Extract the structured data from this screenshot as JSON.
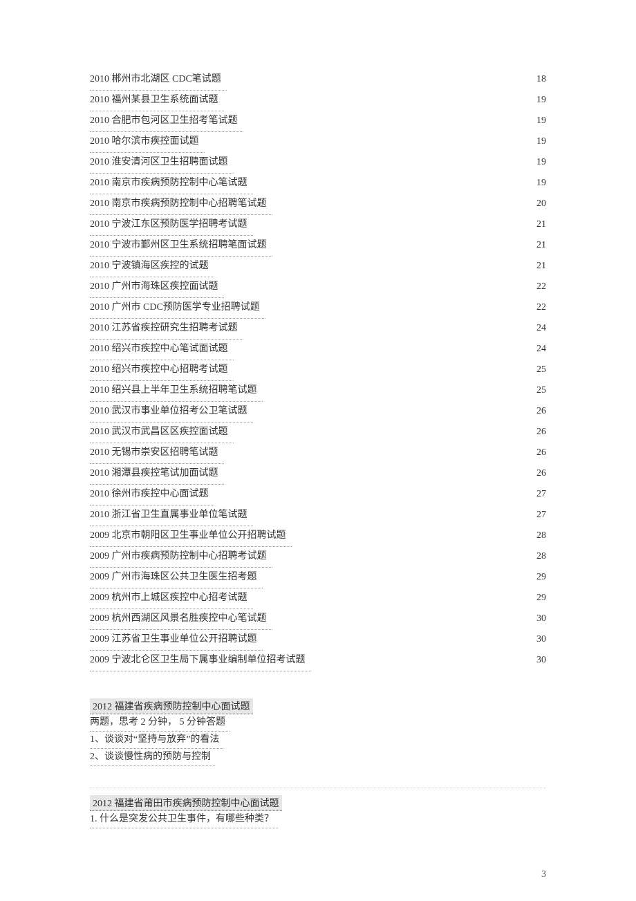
{
  "toc": [
    {
      "title": "2010 郴州市北湖区   CDC笔试题",
      "page": "18"
    },
    {
      "title": "2010 福州某县卫生系统面试题",
      "page": "19"
    },
    {
      "title": "2010 合肥市包河区卫生招考笔试题",
      "page": "19"
    },
    {
      "title": "2010 哈尔滨市疾控面试题",
      "page": "19"
    },
    {
      "title": "2010 淮安清河区卫生招聘面试题",
      "page": "19"
    },
    {
      "title": "2010 南京市疾病预防控制中心笔试题",
      "page": "19"
    },
    {
      "title": "2010 南京市疾病预防控制中心招聘笔试题",
      "page": "20"
    },
    {
      "title": "2010 宁波江东区预防医学招聘考试题",
      "page": "21"
    },
    {
      "title": "2010 宁波市鄞州区卫生系统招聘笔面试题",
      "page": "21"
    },
    {
      "title": "2010 宁波镇海区疾控的试题",
      "page": "21"
    },
    {
      "title": "2010 广州市海珠区疾控面试题",
      "page": "22"
    },
    {
      "title": "2010 广州市  CDC预防医学专业招聘试题",
      "page": "22"
    },
    {
      "title": "2010 江苏省疾控研究生招聘考试题",
      "page": "24"
    },
    {
      "title": "2010 绍兴市疾控中心笔试面试题",
      "page": "24"
    },
    {
      "title": "2010 绍兴市疾控中心招聘考试题",
      "page": "25"
    },
    {
      "title": "2010 绍兴县上半年卫生系统招聘笔试题",
      "page": "25"
    },
    {
      "title": "2010 武汉市事业单位招考公卫笔试题",
      "page": "26"
    },
    {
      "title": "2010 武汉市武昌区区疾控面试题",
      "page": "26"
    },
    {
      "title": "2010 无锡市崇安区招聘笔试题",
      "page": "26"
    },
    {
      "title": "2010 湘潭县疾控笔试加面试题",
      "page": "26"
    },
    {
      "title": "2010 徐州市疾控中心面试题",
      "page": "27"
    },
    {
      "title": "2010 浙江省卫生直属事业单位笔试题",
      "page": "27"
    },
    {
      "title": "2009 北京市朝阳区卫生事业单位公开招聘试题",
      "page": "28"
    },
    {
      "title": "2009 广州市疾病预防控制中心招聘考试题",
      "page": "28"
    },
    {
      "title": "2009 广州市海珠区公共卫生医生招考题",
      "page": "29"
    },
    {
      "title": "2009 杭州市上城区疾控中心招考试题",
      "page": "29"
    },
    {
      "title": "2009 杭州西湖区风景名胜疾控中心笔试题",
      "page": "30"
    },
    {
      "title": "2009 江苏省卫生事业单位公开招聘试题",
      "page": "30"
    },
    {
      "title": "2009 宁波北仑区卫生局下属事业编制单位招考试题",
      "page": "30"
    }
  ],
  "section1": {
    "heading": "2012 福建省疾病预防控制中心面试题",
    "lines": [
      "两题，思考  2 分钟， 5 分钟答题",
      "1、谈谈对“坚持与放弃”的看法",
      "2、谈谈慢性病的预防与控制"
    ]
  },
  "section2": {
    "heading": "2012 福建省莆田市疾病预防控制中心面试题",
    "lines": [
      "1. 什么是突发公共卫生事件，有哪些种类？"
    ]
  },
  "pageNumber": "3"
}
